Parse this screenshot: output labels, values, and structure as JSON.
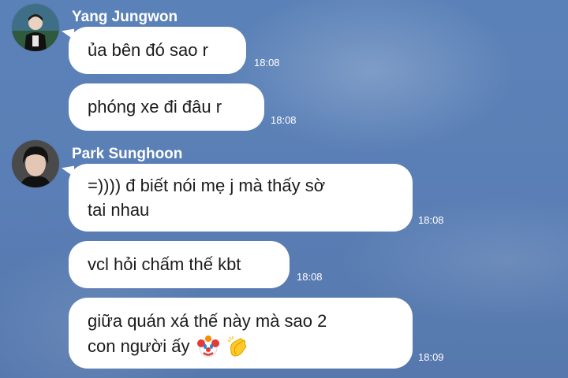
{
  "messages": [
    {
      "sender": "Yang Jungwon",
      "bubbles": [
        {
          "text": "ủa bên đó sao r",
          "time": "18:08"
        },
        {
          "text": "phóng xe đi đâu r",
          "time": "18:08"
        }
      ]
    },
    {
      "sender": "Park Sunghoon",
      "bubbles": [
        {
          "line1": "=)))) đ biết nói mẹ j mà thấy sờ",
          "line2": "tai nhau",
          "time": "18:08"
        },
        {
          "text": "vcl hỏi chấm thế kbt",
          "time": "18:08"
        },
        {
          "line1": "giữa quán xá thế này mà sao 2",
          "line2": "con người ấy",
          "emojis": [
            "clown-face",
            "clapping-hands"
          ],
          "time": "18:09"
        }
      ]
    }
  ],
  "colors": {
    "bubble": "#ffffff",
    "background": "#5a7fb6",
    "text": "#1b1b1b"
  }
}
